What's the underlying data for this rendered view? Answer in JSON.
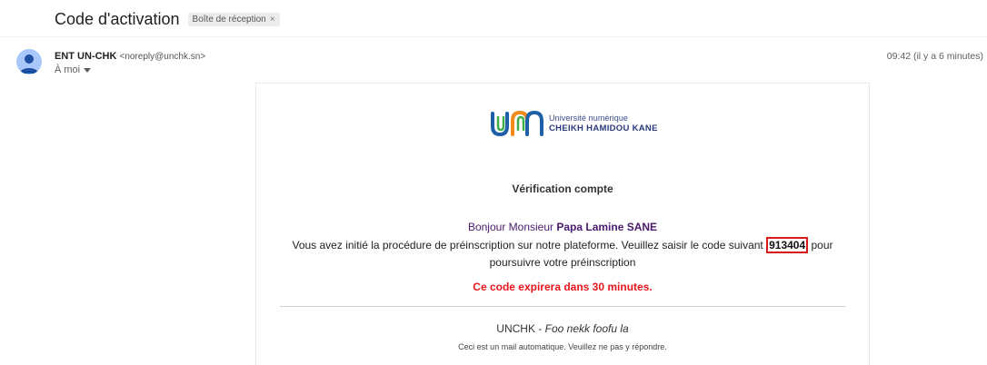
{
  "email": {
    "subject": "Code d'activation",
    "label": "Boîte de réception",
    "label_close": "×",
    "sender_name": "ENT UN-CHK",
    "sender_email": "<noreply@unchk.sn>",
    "recipient": "À moi",
    "time": "09:42 (il y a 6 minutes)"
  },
  "content": {
    "logo_line1": "Université numérique",
    "logo_line2": "CHEIKH HAMIDOU KANE",
    "title": "Vérification compte",
    "greeting_prefix": "Bonjour Monsieur ",
    "greeting_name": "Papa Lamine SANE",
    "body_before_code": "Vous avez initié la procédure de préinscription sur notre plateforme. Veuillez saisir le code suivant ",
    "code": "913404",
    "body_after_code": " pour poursuivre votre préinscription",
    "warning": "Ce code expirera dans 30 minutes.",
    "footer_brand": "UNCHK - ",
    "footer_motto": "Foo nekk foofu la",
    "footer_note": "Ceci est un mail automatique. Veuillez ne pas y répondre."
  },
  "colors": {
    "warning": "#e8151b",
    "greeting": "#4a1a6e",
    "code_highlight": "#d7191c",
    "avatar": "#a8c7fa"
  },
  "icons": {
    "avatar": "person-icon",
    "recipient_dropdown": "caret-down-icon"
  }
}
